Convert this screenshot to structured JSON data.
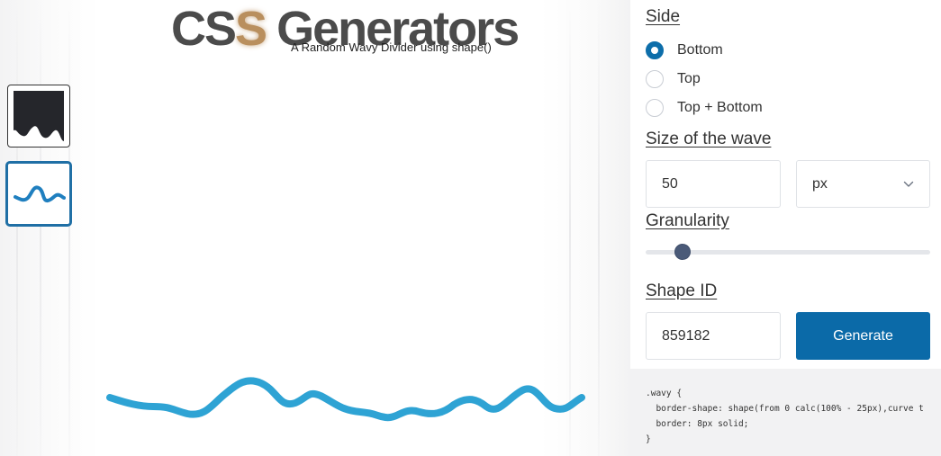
{
  "header": {
    "logo_css_c": "C",
    "logo_css_s1": "S",
    "logo_css_s2": "S",
    "logo_generators": "Generators",
    "subtitle": "A Random Wavy Divider using shape()"
  },
  "thumbnails": [
    {
      "name": "thumb-dark-wave-shape",
      "selected": false
    },
    {
      "name": "thumb-border-wave-shape",
      "selected": true
    }
  ],
  "panel": {
    "side": {
      "title": "Side",
      "options": [
        {
          "label": "Bottom",
          "checked": true
        },
        {
          "label": "Top",
          "checked": false
        },
        {
          "label": "Top + Bottom",
          "checked": false
        }
      ]
    },
    "size": {
      "title": "Size of the wave",
      "value": "50",
      "unit": "px"
    },
    "granularity": {
      "title": "Granularity",
      "value_fraction": 0.13
    },
    "shape_id": {
      "title": "Shape ID",
      "value": "859182",
      "button_label": "Generate"
    },
    "code": {
      "line1": ".wavy {",
      "line2": "  border-shape: shape(from 0 calc(100% - 25px),curve t",
      "line3": "  border: 8px solid;",
      "line4": "}"
    }
  },
  "colors": {
    "accent": "#0b6aa8",
    "wave": "#2ea3d4",
    "logo_gray": "#4b4b4b",
    "logo_gold": "#b98f5e",
    "slider_thumb": "#4a5a78"
  }
}
